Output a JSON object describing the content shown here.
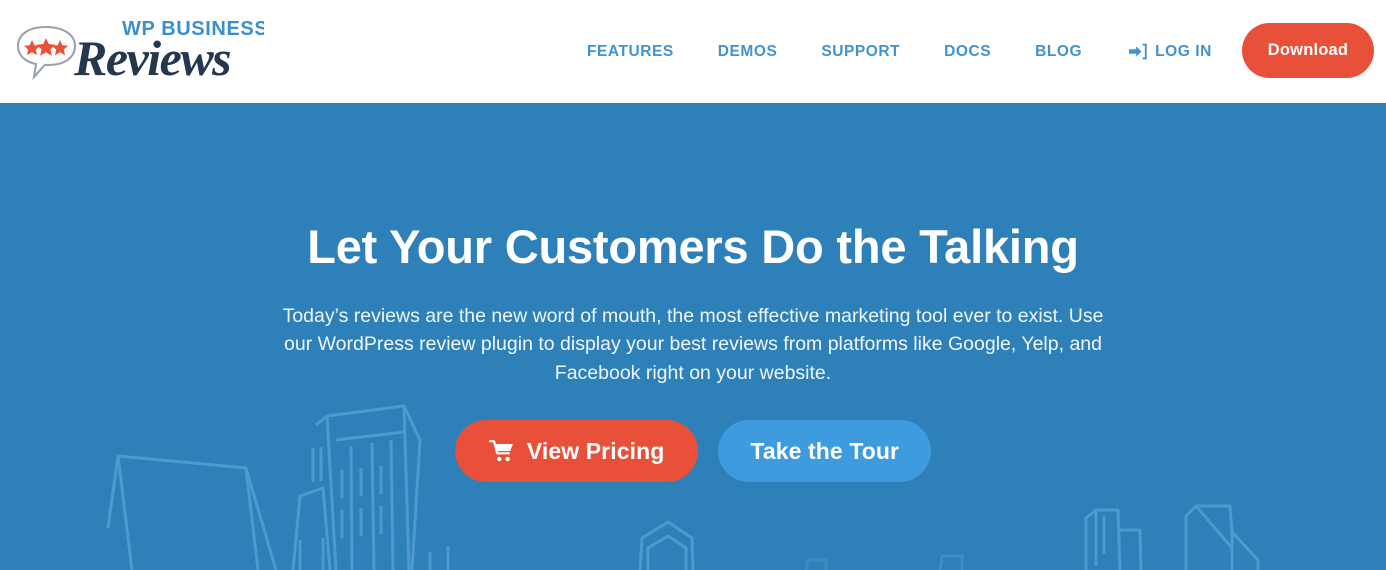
{
  "header": {
    "logo": {
      "name": "wp-business-reviews-logo",
      "top_text": "WP BUSINESS",
      "script_text": "Reviews",
      "bubble_icon": "speech-bubble-stars-icon",
      "star_count": 3,
      "top_text_color": "#3a8fd0",
      "script_text_color": "#24374f",
      "star_color": "#e8503a"
    },
    "nav": [
      {
        "label": "FEATURES",
        "name": "nav-item-features"
      },
      {
        "label": "DEMOS",
        "name": "nav-item-demos"
      },
      {
        "label": "SUPPORT",
        "name": "nav-item-support"
      },
      {
        "label": "DOCS",
        "name": "nav-item-docs"
      },
      {
        "label": "BLOG",
        "name": "nav-item-blog"
      }
    ],
    "login": {
      "label": "LOG IN",
      "icon": "sign-in-arrow-icon"
    },
    "download_label": "Download",
    "nav_color": "#4392cd",
    "accent_color": "#e8503a"
  },
  "hero": {
    "title": "Let Your Customers Do the Talking",
    "subtitle": "Today’s reviews are the new word of mouth, the most effective marketing tool ever to exist. Use our WordPress review plugin to display your best reviews from platforms like Google, Yelp, and Facebook right on your website.",
    "subtitle_line1": "Today’s reviews are the new word of mouth, the most effective marketing tool ever to exist.",
    "subtitle_line2": "Use our WordPress review plugin to display your best reviews from platforms like Google,",
    "subtitle_line3": "Yelp, and Facebook right on your website.",
    "primary_cta": {
      "label": "View Pricing",
      "icon": "shopping-cart-icon",
      "color": "#e8503a"
    },
    "secondary_cta": {
      "label": "Take the Tour",
      "color": "#3e9bdd"
    },
    "background_color": "#2e80b8",
    "background_illustration": "city-skyline-outline"
  }
}
